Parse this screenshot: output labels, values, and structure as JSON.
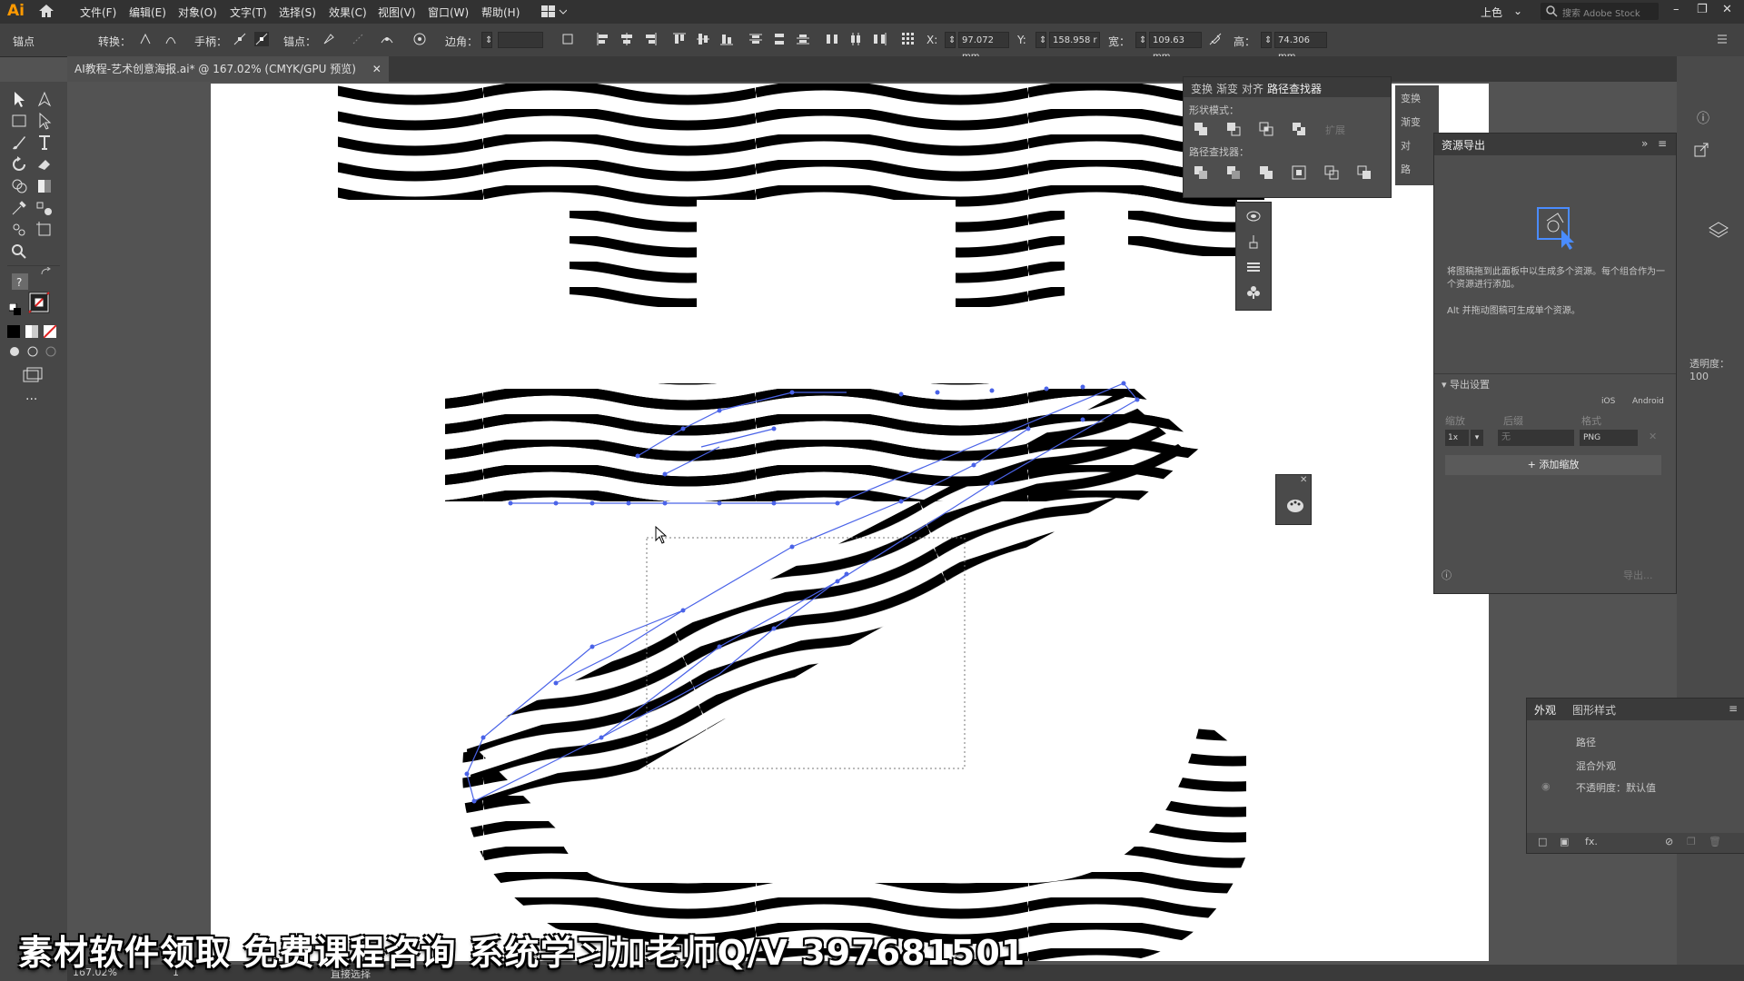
{
  "app": {
    "logo": "Ai"
  },
  "menu": [
    "文件(F)",
    "编辑(E)",
    "对象(O)",
    "文字(T)",
    "选择(S)",
    "效果(C)",
    "视图(V)",
    "窗口(W)",
    "帮助(H)"
  ],
  "workspace": "上色",
  "search_placeholder": "搜索 Adobe Stock",
  "control": {
    "anchor_label": "锚点",
    "convert_label": "转换：",
    "handle_label": "手柄：",
    "anchor2_label": "锚点：",
    "corner_label": "边角：",
    "x_label": "X:",
    "x_value": "97.072 mm",
    "y_label": "Y:",
    "y_value": "158.958 r",
    "w_label": "宽：",
    "w_value": "109.63 mm",
    "h_label": "高：",
    "h_value": "74.306 mm"
  },
  "document_tab": "AI教程-艺术创意海报.ai* @ 167.02% (CMYK/GPU 预览)",
  "pathfinder": {
    "tabs": [
      "变换",
      "渐变",
      "对齐",
      "路径查找器"
    ],
    "shape_modes_label": "形状模式：",
    "expand_label": "扩展",
    "pathfinders_label": "路径查找器："
  },
  "side_strip": {
    "items": [
      "变换",
      "渐变",
      "对",
      "路"
    ]
  },
  "asset_export": {
    "title": "资源导出",
    "hint1": "将图稿拖到此面板中以生成多个资源。每个组合作为一个资源进行添加。",
    "hint2": "Alt 并拖动图稿可生成单个资源。",
    "export_settings": "导出设置",
    "ios": "iOS",
    "android": "Android",
    "scale_label": "缩放",
    "suffix_label": "后缀",
    "format_label": "格式",
    "scale_value": "1x",
    "suffix_value": "无",
    "format_value": "PNG",
    "add_scale": "+ 添加缩放",
    "export_btn": "导出..."
  },
  "opacity_partial": "透明度：100",
  "appearance": {
    "tabs": [
      "外观",
      "图形样式"
    ],
    "path": "路径",
    "mixed": "混合外观",
    "opacity": "不透明度：默认值"
  },
  "status": {
    "zoom": "167.02%",
    "artboard": "1",
    "tool": "直接选择"
  },
  "subtitle": "素材软件领取 免费课程咨询 系统学习加老师Q/V 397681501",
  "colors": {
    "accent": "#4a63e8",
    "ui_dark": "#323232",
    "ui_mid": "#535353",
    "artboard": "#ffffff"
  }
}
